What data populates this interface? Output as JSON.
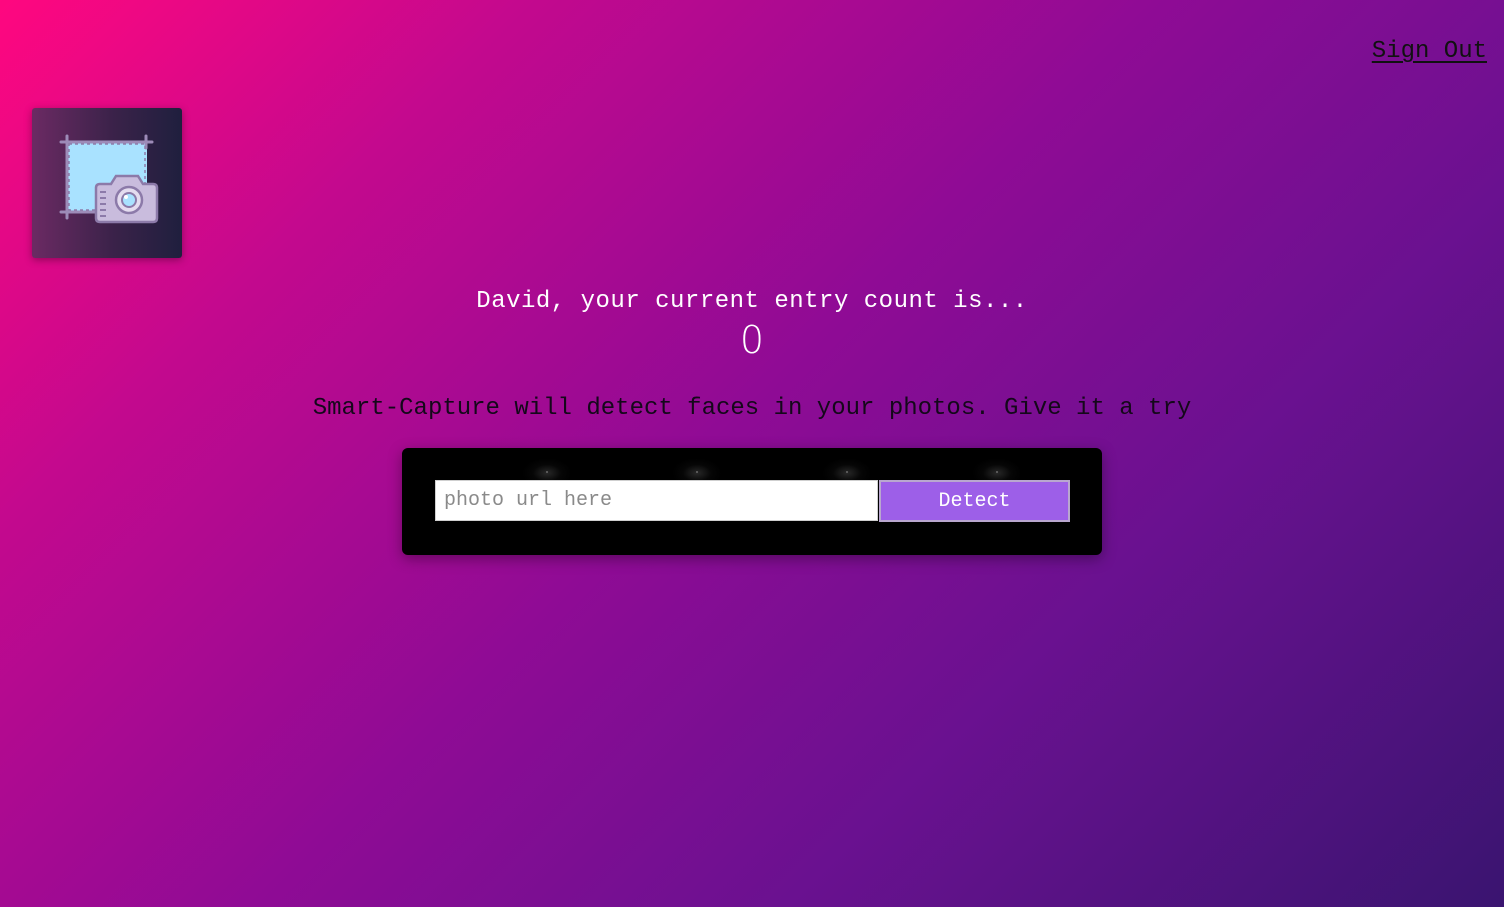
{
  "nav": {
    "sign_out_label": "Sign Out"
  },
  "logo": {
    "icon": "screenshot-camera-icon"
  },
  "rank": {
    "message": "David, your current entry count is...",
    "count": "0"
  },
  "intro": {
    "text": "Smart-Capture will detect faces in your photos. Give it a try"
  },
  "image_form": {
    "input_placeholder": "photo url here",
    "input_value": "",
    "button_label": "Detect"
  },
  "colors": {
    "gradient_start": "#ff077f",
    "gradient_end": "#3a1470",
    "button_accent": "#9d5fe8",
    "panel_background": "#000000"
  }
}
